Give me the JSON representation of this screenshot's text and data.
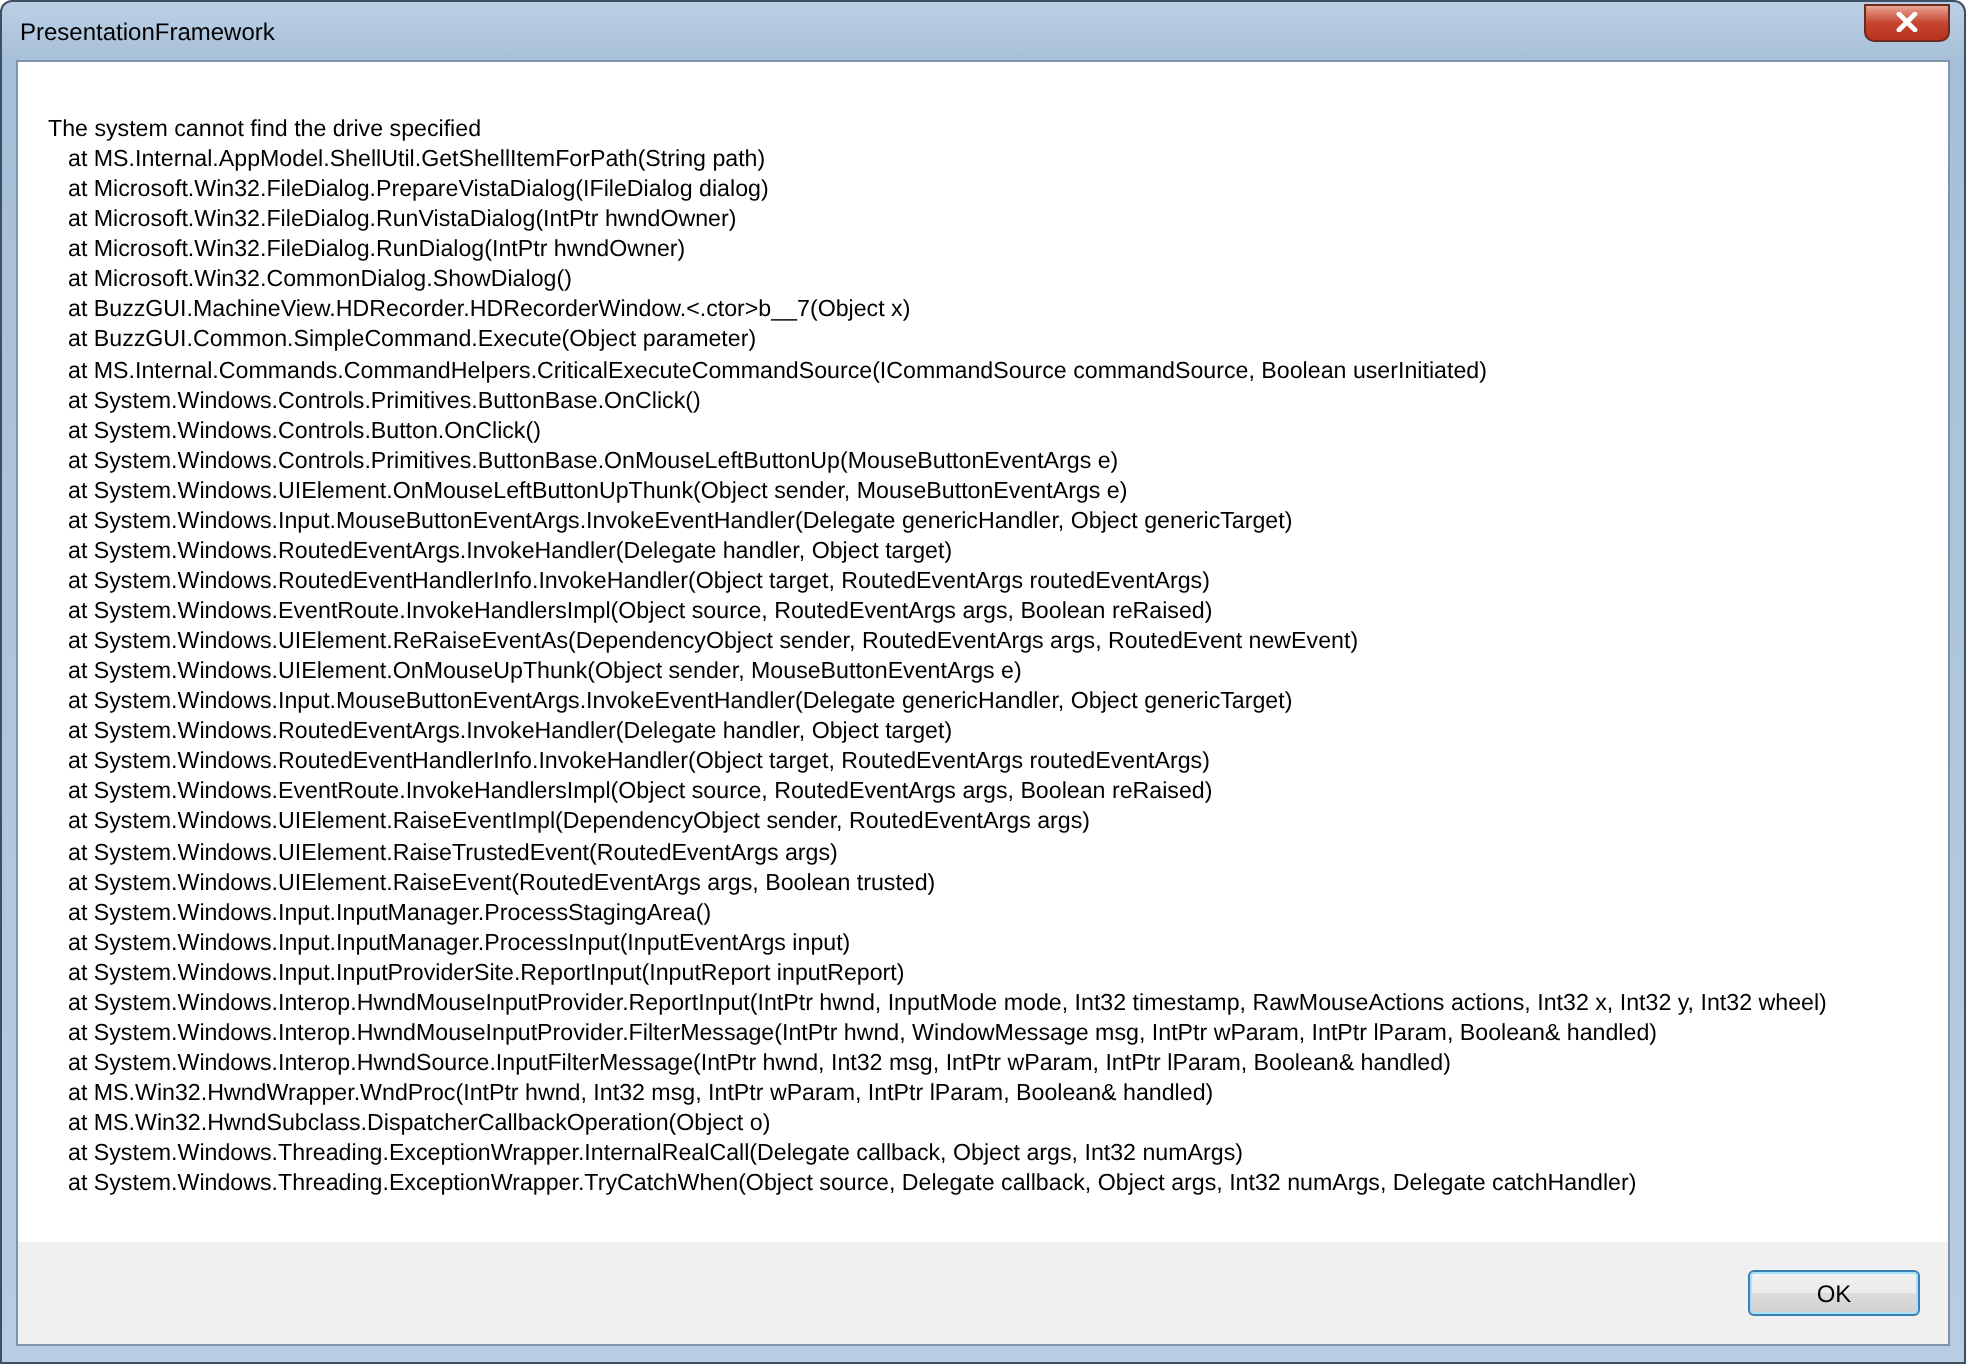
{
  "window": {
    "title": "PresentationFramework"
  },
  "message": "The system cannot find the drive specified",
  "stack": [
    "at MS.Internal.AppModel.ShellUtil.GetShellItemForPath(String path)",
    "at Microsoft.Win32.FileDialog.PrepareVistaDialog(IFileDialog dialog)",
    "at Microsoft.Win32.FileDialog.RunVistaDialog(IntPtr hwndOwner)",
    "at Microsoft.Win32.FileDialog.RunDialog(IntPtr hwndOwner)",
    "at Microsoft.Win32.CommonDialog.ShowDialog()",
    "at BuzzGUI.MachineView.HDRecorder.HDRecorderWindow.<.ctor>b__7(Object x)",
    "at BuzzGUI.Common.SimpleCommand.Execute(Object parameter)",
    "at MS.Internal.Commands.CommandHelpers.CriticalExecuteCommandSource(ICommandSource commandSource, Boolean userInitiated)",
    "at System.Windows.Controls.Primitives.ButtonBase.OnClick()",
    "at System.Windows.Controls.Button.OnClick()",
    "at System.Windows.Controls.Primitives.ButtonBase.OnMouseLeftButtonUp(MouseButtonEventArgs e)",
    "at System.Windows.UIElement.OnMouseLeftButtonUpThunk(Object sender, MouseButtonEventArgs e)",
    "at System.Windows.Input.MouseButtonEventArgs.InvokeEventHandler(Delegate genericHandler, Object genericTarget)",
    "at System.Windows.RoutedEventArgs.InvokeHandler(Delegate handler, Object target)",
    "at System.Windows.RoutedEventHandlerInfo.InvokeHandler(Object target, RoutedEventArgs routedEventArgs)",
    "at System.Windows.EventRoute.InvokeHandlersImpl(Object source, RoutedEventArgs args, Boolean reRaised)",
    "at System.Windows.UIElement.ReRaiseEventAs(DependencyObject sender, RoutedEventArgs args, RoutedEvent newEvent)",
    "at System.Windows.UIElement.OnMouseUpThunk(Object sender, MouseButtonEventArgs e)",
    "at System.Windows.Input.MouseButtonEventArgs.InvokeEventHandler(Delegate genericHandler, Object genericTarget)",
    "at System.Windows.RoutedEventArgs.InvokeHandler(Delegate handler, Object target)",
    "at System.Windows.RoutedEventHandlerInfo.InvokeHandler(Object target, RoutedEventArgs routedEventArgs)",
    "at System.Windows.EventRoute.InvokeHandlersImpl(Object source, RoutedEventArgs args, Boolean reRaised)",
    "at System.Windows.UIElement.RaiseEventImpl(DependencyObject sender, RoutedEventArgs args)",
    "at System.Windows.UIElement.RaiseTrustedEvent(RoutedEventArgs args)",
    "at System.Windows.UIElement.RaiseEvent(RoutedEventArgs args, Boolean trusted)",
    "at System.Windows.Input.InputManager.ProcessStagingArea()",
    "at System.Windows.Input.InputManager.ProcessInput(InputEventArgs input)",
    "at System.Windows.Input.InputProviderSite.ReportInput(InputReport inputReport)",
    "at System.Windows.Interop.HwndMouseInputProvider.ReportInput(IntPtr hwnd, InputMode mode, Int32 timestamp, RawMouseActions actions, Int32 x, Int32 y, Int32 wheel)",
    "at System.Windows.Interop.HwndMouseInputProvider.FilterMessage(IntPtr hwnd, WindowMessage msg, IntPtr wParam, IntPtr lParam, Boolean& handled)",
    "at System.Windows.Interop.HwndSource.InputFilterMessage(IntPtr hwnd, Int32 msg, IntPtr wParam, IntPtr lParam, Boolean& handled)",
    "at MS.Win32.HwndWrapper.WndProc(IntPtr hwnd, Int32 msg, IntPtr wParam, IntPtr lParam, Boolean& handled)",
    "at MS.Win32.HwndSubclass.DispatcherCallbackOperation(Object o)",
    "at System.Windows.Threading.ExceptionWrapper.InternalRealCall(Delegate callback, Object args, Int32 numArgs)",
    "at System.Windows.Threading.ExceptionWrapper.TryCatchWhen(Object source, Delegate callback, Object args, Int32 numArgs, Delegate catchHandler)"
  ],
  "buttons": [
    "OK"
  ]
}
